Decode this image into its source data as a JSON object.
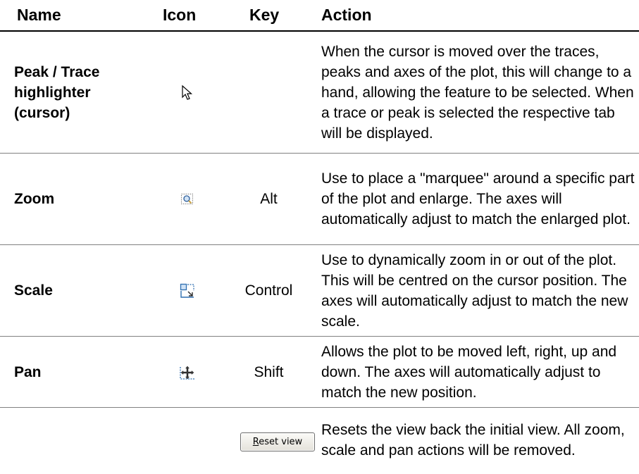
{
  "headers": {
    "name": "Name",
    "icon": "Icon",
    "key": "Key",
    "action": "Action"
  },
  "rows": [
    {
      "name_lines": [
        "Peak / Trace",
        "highlighter",
        "(cursor)"
      ],
      "icon": "arrow-cursor-icon",
      "key": "",
      "action": "When the cursor is moved over the traces, peaks and axes of the plot, this will change to a hand, allowing the feature to be selected. When a trace or peak is selected the respective tab will be displayed."
    },
    {
      "name": "Zoom",
      "icon": "zoom-marquee-icon",
      "key": "Alt",
      "action": "Use to place a \"marquee\" around a specific part of the plot and enlarge. The axes will automatically adjust to match the enlarged plot."
    },
    {
      "name": "Scale",
      "icon": "scale-icon",
      "key": "Control",
      "action": "Use to dynamically zoom in or out of the plot. This will be centred on the cursor position. The axes will automatically adjust to match the new scale."
    },
    {
      "name": "Pan",
      "icon": "pan-icon",
      "key": "Shift",
      "action": "Allows the plot to be moved left, right, up and down. The axes will automatically adjust to match the new position."
    },
    {
      "name": "",
      "button_mnemonic": "R",
      "button_rest": "eset view",
      "key": "",
      "action": "Resets the view back the initial view. All zoom, scale and pan actions will be removed."
    }
  ]
}
